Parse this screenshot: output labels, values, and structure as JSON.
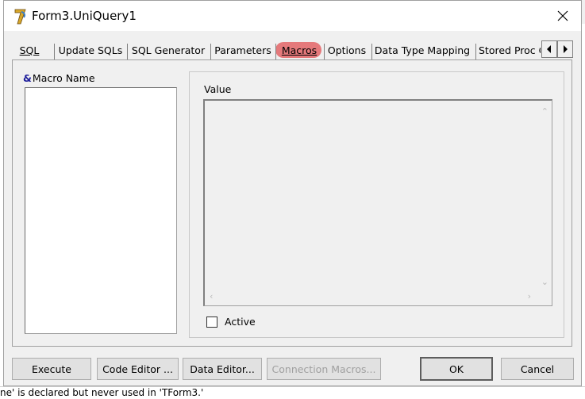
{
  "window": {
    "title": "Form3.UniQuery1"
  },
  "tabs": [
    {
      "label": "SQL",
      "underline_index": 0
    },
    {
      "label": "Update SQLs",
      "underline_index": 0
    },
    {
      "label": "SQL Generator",
      "underline_index": 4
    },
    {
      "label": "Parameters",
      "underline_index": 0
    },
    {
      "label": "Macros",
      "underline_index": 0,
      "active": true
    },
    {
      "label": "Options",
      "underline_index": 0
    },
    {
      "label": "Data Type Mapping",
      "underline_index": 0
    },
    {
      "label": "Stored Proc Ca",
      "underline_index": 0
    }
  ],
  "macros_page": {
    "macro_name_label": "Macro Name",
    "amp_prefix": "&",
    "value_label": "Value",
    "active_label": "Active",
    "active_checked": false
  },
  "buttons": {
    "execute": "Execute",
    "code_editor": "Code Editor ...",
    "data_editor": "Data Editor...",
    "connection_macros": "Connection Macros...",
    "ok": "OK",
    "cancel": "Cancel"
  },
  "background": {
    "status_text": "ne' is declared but never used in 'TForm3.'"
  },
  "colors": {
    "active_tab_highlight": "#e5797b",
    "dialog_bg": "#f0f0f0"
  }
}
